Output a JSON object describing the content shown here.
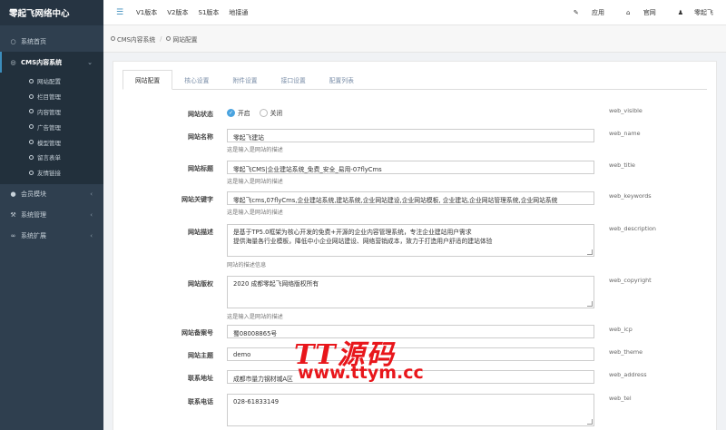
{
  "brand": "零起飞网络中心",
  "sidebar": {
    "items": [
      {
        "label": "系统首页",
        "icon": "circle-icon"
      },
      {
        "label": "CMS内容系统",
        "icon": "circle-icon",
        "active": true
      },
      {
        "label": "会员模块",
        "icon": "users-icon"
      },
      {
        "label": "系统管理",
        "icon": "wrench-icon"
      },
      {
        "label": "系统扩展",
        "icon": "paperclip-icon"
      }
    ],
    "sub_items": [
      "网站配置",
      "栏目管理",
      "内容管理",
      "广告管理",
      "模型管理",
      "留言表单",
      "友情链接"
    ]
  },
  "topbar": {
    "links": [
      "V1版本",
      "V2版本",
      "S1版本",
      "地接通"
    ],
    "right": [
      "应用",
      "官网",
      "零起飞"
    ]
  },
  "breadcrumb": [
    "CMS内容系统",
    "网站配置"
  ],
  "tabs": [
    "网站配置",
    "核心设置",
    "附件设置",
    "接口设置",
    "配置列表"
  ],
  "form": {
    "status": {
      "label": "网站状态",
      "on": "开启",
      "off": "关闭",
      "key": "web_visible"
    },
    "name": {
      "label": "网站名称",
      "value": "零起飞建站",
      "hint": "这是输入是网站的描述",
      "key": "web_name"
    },
    "title": {
      "label": "网站标题",
      "value": "零起飞CMS|企业建站系统_免费_安全_易用-07flyCms",
      "hint": "这是输入是网站的描述",
      "key": "web_title"
    },
    "keywords": {
      "label": "网站关键字",
      "value": "零起飞cms,07flyCms,企业建站系统,建站系统,企业网站建设,企业网站模板, 企业建站,企业网站管理系统,企业网站系统",
      "hint": "这是输入是网站的描述",
      "key": "web_keywords"
    },
    "description": {
      "label": "网站描述",
      "line1": "是基于TP5.0框架为核心开发的免费+开源的企业内容管理系统，专注企业建站用户需求",
      "line2": "提供海量各行业模板，降低中小企业网站建设、网络营销成本，致力于打造用户舒适的建站体验",
      "hint": "网站的描述信息",
      "key": "web_description"
    },
    "copyright": {
      "label": "网站版权",
      "value": "2020 成都零起飞网络版权所有",
      "hint": "这是输入是网站的描述",
      "key": "web_copyright"
    },
    "icp": {
      "label": "网站备案号",
      "value": "蜀08008865号",
      "key": "web_icp"
    },
    "theme": {
      "label": "网站主题",
      "value": "demo",
      "key": "web_theme"
    },
    "address": {
      "label": "联系地址",
      "value": "成都市量力钢材城A区",
      "key": "web_address"
    },
    "tel": {
      "label": "联系电话",
      "value": "028-61833149",
      "key": "web_tel"
    }
  },
  "watermark": {
    "top": "TT源码",
    "bottom": "www.ttym.cc"
  }
}
